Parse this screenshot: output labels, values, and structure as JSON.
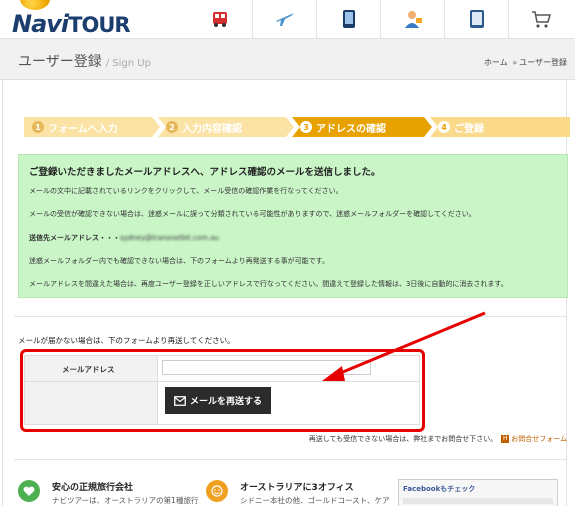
{
  "header": {
    "logo": {
      "main": "Navi",
      "accent": "TOUR"
    },
    "nav_icons": [
      "bus-icon",
      "airplane-icon",
      "phone-icon",
      "user-guide-icon",
      "tablet-icon",
      "cart-icon"
    ]
  },
  "title": {
    "main": "ユーザー登録",
    "sub": "/ Sign Up",
    "breadcrumb": {
      "home": "ホーム",
      "separator": "»",
      "current": "ユーザー登録"
    }
  },
  "steps": [
    {
      "num": "1",
      "label": "フォームへ入力",
      "state": "done"
    },
    {
      "num": "2",
      "label": "入力内容確認",
      "state": "done"
    },
    {
      "num": "3",
      "label": "アドレスの確認",
      "state": "active"
    },
    {
      "num": "4",
      "label": "ご登録",
      "state": "next"
    }
  ],
  "message": {
    "heading": "ご登録いただきましたメールアドレスへ、アドレス確認のメールを送信しました。",
    "p1": "メールの文中に記載されているリンクをクリックして、メール受信の確認作業を行なってください。",
    "p2": "メールの受信が確認できない場合は、迷惑メールに誤って分類されている可能性がありますので、迷惑メールフォルダーを確認してください。",
    "address_label": "送信先メールアドレス・・・",
    "address_value": "sydney@transnetbit.com.au",
    "p3": "迷惑メールフォルダー内でも確認できない場合は、下のフォームより再発送する事が可能です。",
    "p4": "メールアドレスを間違えた場合は、再度ユーザー登録を正しいアドレスで行なってください。間違えて登録した情報は、3日後に自動的に消去されます。"
  },
  "resend": {
    "note": "メールが届かない場合は、下のフォームより再送してください。",
    "email_label": "メールアドレス",
    "email_value": "",
    "button_label": "メールを再送する",
    "contact_note": "再送しても受信できない場合は、弊社までお問合せ下さい。",
    "contact_link": "お問合せフォーム"
  },
  "annotation": {
    "color": "#e60000"
  },
  "features": [
    {
      "title": "安心の正規旅行会社",
      "desc": "ナビツアーは、オーストラリアの第1種旅行",
      "icon": "heart-icon",
      "color": "#4caf50"
    },
    {
      "title": "オーストラリアに3オフィス",
      "desc": "シドニー本社の他、ゴールドコースト、ケア",
      "icon": "smile-icon",
      "color": "#f0a020"
    }
  ],
  "facebook": {
    "title": "Facebookもチェック"
  }
}
